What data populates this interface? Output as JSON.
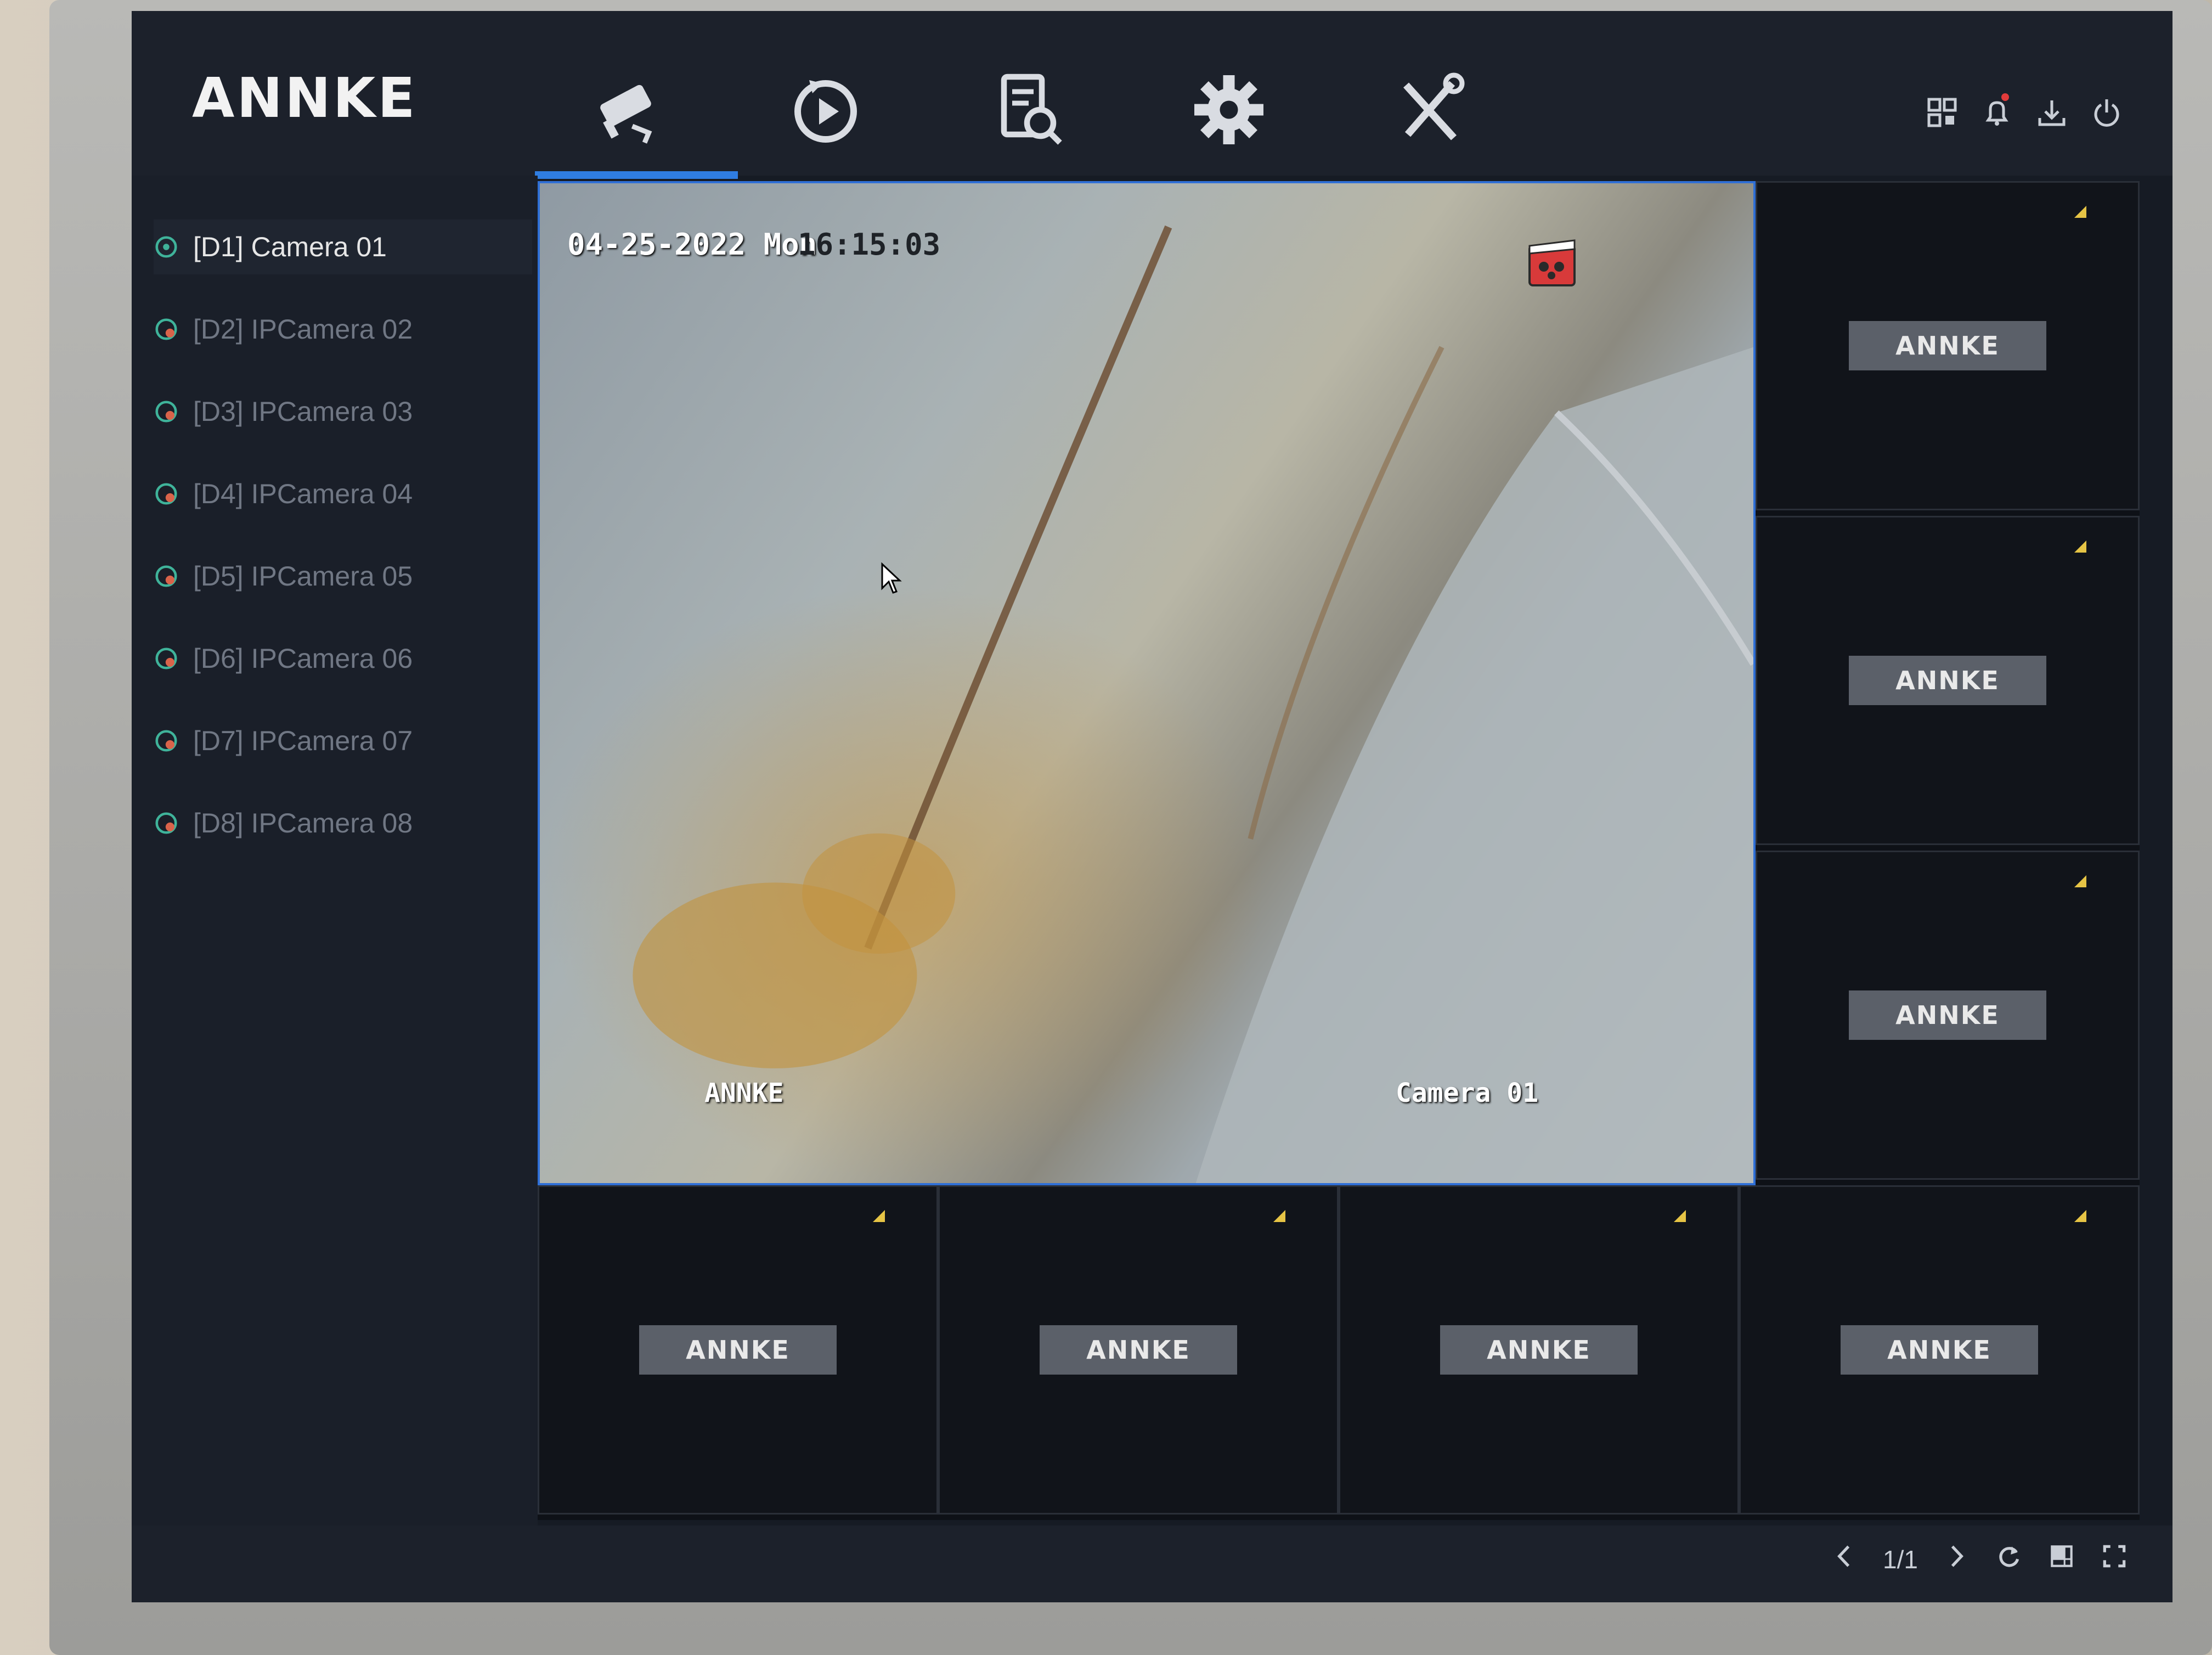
{
  "brand": {
    "logo_text": "ANNKE"
  },
  "top_menu": {
    "tabs": [
      {
        "icon": "camera-icon",
        "active": true
      },
      {
        "icon": "playback-icon",
        "active": false
      },
      {
        "icon": "search-file-icon",
        "active": false
      },
      {
        "icon": "gear-icon",
        "active": false
      },
      {
        "icon": "tools-icon",
        "active": false
      }
    ],
    "system_icons": [
      "qr-code-icon",
      "bell-icon",
      "download-icon",
      "power-icon"
    ],
    "accent_color": "#2f7de1",
    "alert_color": "#e23b3b"
  },
  "sidebar": {
    "cameras": [
      {
        "label": "[D1] Camera 01",
        "active": true
      },
      {
        "label": "[D2] IPCamera 02",
        "active": false
      },
      {
        "label": "[D3] IPCamera 03",
        "active": false
      },
      {
        "label": "[D4] IPCamera 04",
        "active": false
      },
      {
        "label": "[D5] IPCamera 05",
        "active": false
      },
      {
        "label": "[D6] IPCamera 06",
        "active": false
      },
      {
        "label": "[D7] IPCamera 07",
        "active": false
      },
      {
        "label": "[D8] IPCamera 08",
        "active": false
      }
    ]
  },
  "main_view": {
    "osd_date": "04-25-2022 Mon",
    "osd_time": "16:15:03",
    "osd_brand": "ANNKE",
    "osd_channel": "Camera 01",
    "recording_icon": "record-icon",
    "border_color": "#2f6fd6"
  },
  "tiles": [
    {
      "brand": "ANNKE"
    },
    {
      "brand": "ANNKE"
    },
    {
      "brand": "ANNKE"
    },
    {
      "brand": "ANNKE"
    },
    {
      "brand": "ANNKE"
    },
    {
      "brand": "ANNKE"
    },
    {
      "brand": "ANNKE"
    }
  ],
  "bottom_bar": {
    "page_indicator": "1/1",
    "icons": [
      "chevron-left-icon",
      "chevron-right-icon",
      "refresh-icon",
      "layout-icon",
      "fullscreen-icon"
    ]
  }
}
